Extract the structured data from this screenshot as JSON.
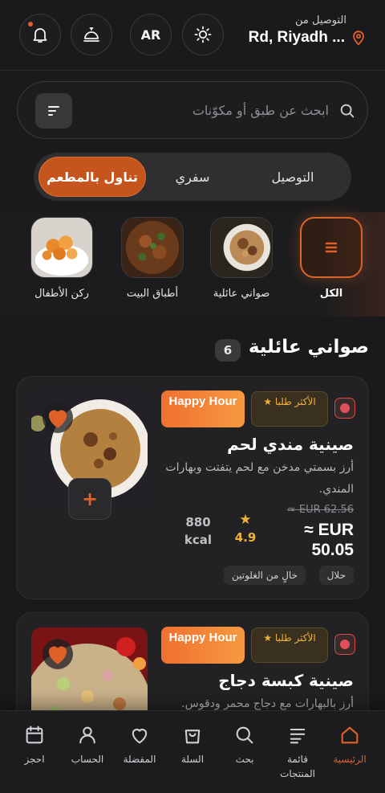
{
  "header": {
    "deliver_label": "التوصيل من",
    "address": "Rd, Riyadh ...",
    "lang_button": "AR"
  },
  "search": {
    "placeholder": "ابحث عن طبق أو مكوّنات"
  },
  "modes": [
    {
      "label": "التوصيل",
      "active": false
    },
    {
      "label": "سفري",
      "active": false
    },
    {
      "label": "تناول بالمطعم",
      "active": true
    }
  ],
  "categories": [
    {
      "label": "الكل",
      "icon": "menu-lines-icon",
      "active": true
    },
    {
      "label": "صواني عائلية",
      "image": "family-tray-image"
    },
    {
      "label": "أطباق البيت",
      "image": "home-dishes-image"
    },
    {
      "label": "ركن الأطفال",
      "image": "kids-corner-image"
    }
  ],
  "section": {
    "title": "صواني عائلية",
    "count": "6"
  },
  "items": [
    {
      "title": "صينية مندي لحم",
      "description": "أرز بسمتي مدخن مع لحم يتفتت وبهارات المندي.",
      "badge_best": "★ الأكثر طلبا",
      "badge_happy": "Happy Hour",
      "old_price": "≈ EUR 62.56",
      "new_price": "≈ EUR 50.05",
      "rating": "4.9",
      "kcal": "880 kcal",
      "tags": [
        "حلال",
        "خالٍ من الغلوتين"
      ]
    },
    {
      "title": "صينية كبسة دجاج",
      "description": "أرز بالبهارات مع دجاج محمر ودقوس.",
      "badge_best": "★ الأكثر طلبا",
      "badge_happy": "Happy Hour"
    }
  ],
  "bottom_nav": [
    {
      "label": "الرئيسية",
      "icon": "home-icon",
      "active": true
    },
    {
      "label": "قائمة المنتجات",
      "icon": "menu-list-icon"
    },
    {
      "label": "بحث",
      "icon": "search-icon"
    },
    {
      "label": "السلة",
      "icon": "cart-icon"
    },
    {
      "label": "المفضلة",
      "icon": "heart-icon"
    },
    {
      "label": "الحساب",
      "icon": "user-icon"
    },
    {
      "label": "احجز",
      "icon": "calendar-icon"
    }
  ],
  "colors": {
    "accent": "#e0602a",
    "background": "#1a1a1c",
    "card": "#222224",
    "gold": "#f0b33a"
  }
}
